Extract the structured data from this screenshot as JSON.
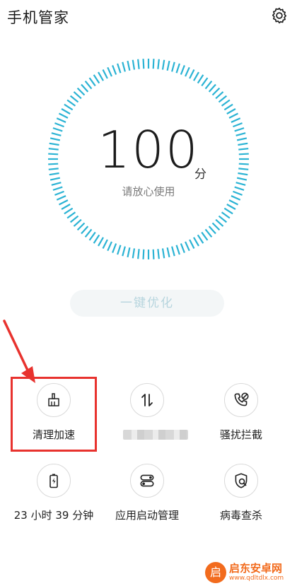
{
  "header": {
    "title": "手机管家",
    "settings_icon": "gear-icon"
  },
  "score": {
    "value": "100",
    "unit": "分",
    "status": "请放心使用",
    "ring_color": "#2bb3d4"
  },
  "optimize_button": {
    "label": "一键优化"
  },
  "tiles": [
    {
      "icon": "broom-icon",
      "label": "清理加速",
      "highlighted": true
    },
    {
      "icon": "data-transfer-icon",
      "label": "",
      "obscured": true
    },
    {
      "icon": "call-block-icon",
      "label": "骚扰拦截"
    },
    {
      "icon": "battery-icon",
      "label": "23 小时 39 分钟"
    },
    {
      "icon": "app-launch-icon",
      "label": "应用启动管理"
    },
    {
      "icon": "virus-scan-icon",
      "label": "病毒查杀"
    }
  ],
  "annotation": {
    "color": "#e8322e"
  },
  "watermark": {
    "logo_char": "启",
    "name": "启东安卓网",
    "url": "www.qdltdlx.com",
    "color": "#f26b1d"
  }
}
